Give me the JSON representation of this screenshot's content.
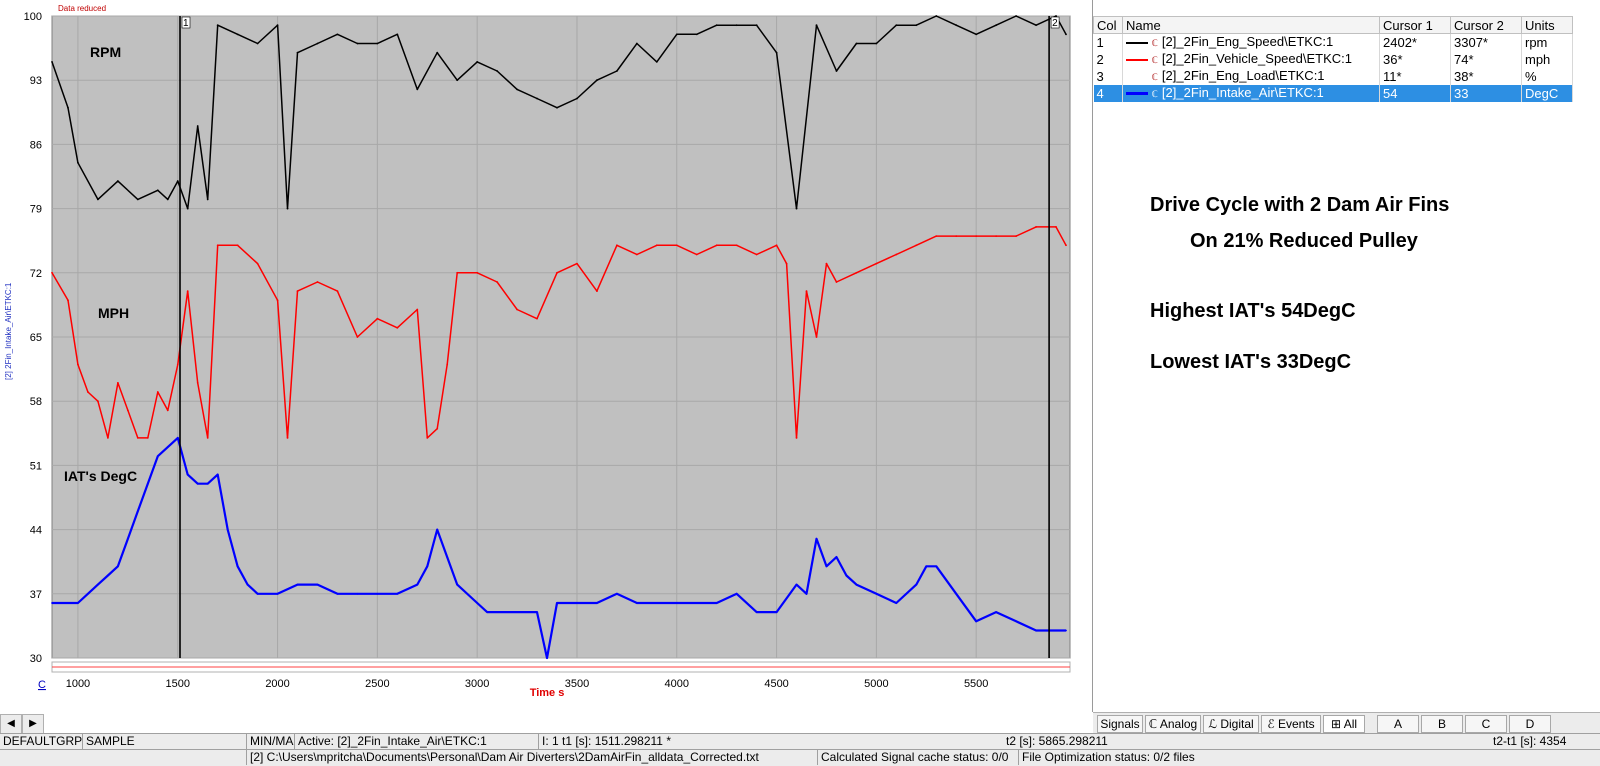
{
  "plot": {
    "header_label": "Data reduced",
    "vertical_axis_label": "[2] 2Fin_Intake_Air\\ETKC:1",
    "y_ticks": [
      "100",
      "93",
      "86",
      "79",
      "72",
      "65",
      "58",
      "51",
      "44",
      "37",
      "30"
    ],
    "x_ticks": [
      "1000",
      "1500",
      "2000",
      "2500",
      "3000",
      "3500",
      "4000",
      "4500",
      "5000",
      "5500"
    ],
    "x_axis_label": "Time  s",
    "cursor1_label": "1",
    "cursor2_label": "2",
    "corner_label": "C",
    "labels": {
      "rpm": "RPM",
      "mph": "MPH",
      "iat": "IAT's DegC"
    }
  },
  "chart_data": {
    "type": "line",
    "xlim": [
      870,
      5970
    ],
    "ylim": [
      30,
      100
    ],
    "x_tick_values": [
      1000,
      1500,
      2000,
      2500,
      3000,
      3500,
      4000,
      4500,
      5000,
      5500
    ],
    "y_tick_values": [
      100,
      93,
      86,
      79,
      72,
      65,
      58,
      51,
      44,
      37,
      30
    ],
    "cursors": [
      1511.3,
      5865.3
    ],
    "series": [
      {
        "name": "[2]_2Fin_Eng_Speed\\ETKC:1",
        "color": "#000000",
        "x": [
          870,
          950,
          1000,
          1100,
          1200,
          1300,
          1400,
          1450,
          1500,
          1550,
          1600,
          1650,
          1700,
          1800,
          1900,
          2000,
          2050,
          2100,
          2200,
          2300,
          2400,
          2500,
          2600,
          2700,
          2800,
          2900,
          3000,
          3100,
          3200,
          3300,
          3400,
          3500,
          3600,
          3700,
          3800,
          3900,
          4000,
          4100,
          4200,
          4300,
          4400,
          4500,
          4600,
          4700,
          4800,
          4900,
          5000,
          5100,
          5200,
          5300,
          5400,
          5500,
          5600,
          5700,
          5800,
          5900,
          5950
        ],
        "y": [
          95,
          90,
          84,
          80,
          82,
          80,
          81,
          80,
          82,
          79,
          88,
          80,
          99,
          98,
          97,
          99,
          79,
          96,
          97,
          98,
          97,
          97,
          98,
          92,
          96,
          93,
          95,
          94,
          92,
          91,
          90,
          91,
          93,
          94,
          97,
          95,
          98,
          98,
          99,
          99,
          99,
          96,
          79,
          99,
          94,
          97,
          97,
          99,
          99,
          100,
          99,
          98,
          99,
          100,
          99,
          100,
          98
        ]
      },
      {
        "name": "[2]_2Fin_Vehicle_Speed\\ETKC:1",
        "color": "#ff0000",
        "x": [
          870,
          950,
          1000,
          1050,
          1100,
          1150,
          1200,
          1250,
          1300,
          1350,
          1400,
          1450,
          1500,
          1550,
          1600,
          1650,
          1700,
          1800,
          1900,
          2000,
          2050,
          2100,
          2200,
          2300,
          2400,
          2500,
          2600,
          2700,
          2750,
          2800,
          2850,
          2900,
          3000,
          3100,
          3200,
          3300,
          3400,
          3500,
          3600,
          3700,
          3800,
          3900,
          4000,
          4100,
          4200,
          4300,
          4400,
          4500,
          4550,
          4600,
          4650,
          4700,
          4750,
          4800,
          4900,
          5000,
          5100,
          5200,
          5300,
          5400,
          5500,
          5600,
          5700,
          5800,
          5900,
          5950
        ],
        "y": [
          72,
          69,
          62,
          59,
          58,
          54,
          60,
          57,
          54,
          54,
          59,
          57,
          62,
          70,
          60,
          54,
          75,
          75,
          73,
          69,
          54,
          70,
          71,
          70,
          65,
          67,
          66,
          68,
          54,
          55,
          62,
          72,
          72,
          71,
          68,
          67,
          72,
          73,
          70,
          75,
          74,
          75,
          75,
          74,
          75,
          75,
          74,
          75,
          73,
          54,
          70,
          65,
          73,
          71,
          72,
          73,
          74,
          75,
          76,
          76,
          76,
          76,
          76,
          77,
          77,
          75
        ]
      },
      {
        "name": "[2]_2Fin_Intake_Air\\ETKC:1",
        "color": "#0000ff",
        "x": [
          870,
          950,
          1000,
          1050,
          1100,
          1150,
          1200,
          1250,
          1300,
          1350,
          1400,
          1450,
          1500,
          1550,
          1600,
          1650,
          1700,
          1750,
          1800,
          1850,
          1900,
          2000,
          2100,
          2200,
          2300,
          2400,
          2500,
          2600,
          2700,
          2750,
          2800,
          2850,
          2900,
          3000,
          3050,
          3100,
          3200,
          3300,
          3350,
          3400,
          3500,
          3600,
          3700,
          3800,
          3900,
          4000,
          4100,
          4200,
          4300,
          4400,
          4500,
          4600,
          4650,
          4700,
          4750,
          4800,
          4850,
          4900,
          5000,
          5100,
          5200,
          5250,
          5300,
          5400,
          5500,
          5600,
          5700,
          5800,
          5900,
          5950
        ],
        "y": [
          36,
          36,
          36,
          37,
          38,
          39,
          40,
          43,
          46,
          49,
          52,
          53,
          54,
          50,
          49,
          49,
          50,
          44,
          40,
          38,
          37,
          37,
          38,
          38,
          37,
          37,
          37,
          37,
          38,
          40,
          44,
          41,
          38,
          36,
          35,
          35,
          35,
          35,
          30,
          36,
          36,
          36,
          37,
          36,
          36,
          36,
          36,
          36,
          37,
          35,
          35,
          38,
          37,
          43,
          40,
          41,
          39,
          38,
          37,
          36,
          38,
          40,
          40,
          37,
          34,
          35,
          34,
          33,
          33,
          33
        ]
      }
    ]
  },
  "signal_table": {
    "headers": [
      "Col",
      "Name",
      "Cursor 1",
      "Cursor 2",
      "Units"
    ],
    "rows": [
      {
        "index": "1",
        "color": "#000000",
        "name": "[2]_2Fin_Eng_Speed\\ETKC:1",
        "cursor1": "2402*",
        "cursor2": "3307*",
        "units": "rpm"
      },
      {
        "index": "2",
        "color": "#ff0000",
        "name": "[2]_2Fin_Vehicle_Speed\\ETKC:1",
        "cursor1": "36*",
        "cursor2": "74*",
        "units": "mph"
      },
      {
        "index": "3",
        "color": "#d0d0d0",
        "name": "[2]_2Fin_Eng_Load\\ETKC:1",
        "cursor1": "11*",
        "cursor2": "38*",
        "units": "%"
      },
      {
        "index": "4",
        "color": "#0000ff",
        "name": "[2]_2Fin_Intake_Air\\ETKC:1",
        "cursor1": "54",
        "cursor2": "33",
        "units": "DegC"
      }
    ]
  },
  "notes": {
    "title_line1": "Drive Cycle with 2 Dam Air Fins",
    "title_line2": "On 21% Reduced Pulley",
    "highest": "Highest IAT's 54DegC",
    "lowest": "Lowest IAT's 33DegC"
  },
  "tabs": [
    "Signals",
    "Analog",
    "Digital",
    "Events",
    "All",
    "A",
    "B",
    "C",
    "D"
  ],
  "status": {
    "group": "DEFAULTGRP",
    "mode": "SAMPLE",
    "minmax": "MIN/MA",
    "active": "Active:  [2]_2Fin_Intake_Air\\ETKC:1",
    "t1": "I: 1 t1 [s]: 1511.298211 *",
    "t2": "t2 [s]: 5865.298211",
    "t2t1": "t2-t1 [s]: 4354",
    "file_path": "[2]  C:\\Users\\mpritcha\\Documents\\Personal\\Dam Air Diverters\\2DamAirFin_alldata_Corrected.txt",
    "cache": "Calculated Signal cache status:  0/0",
    "optimization": "File Optimization status: 0/2 files"
  }
}
